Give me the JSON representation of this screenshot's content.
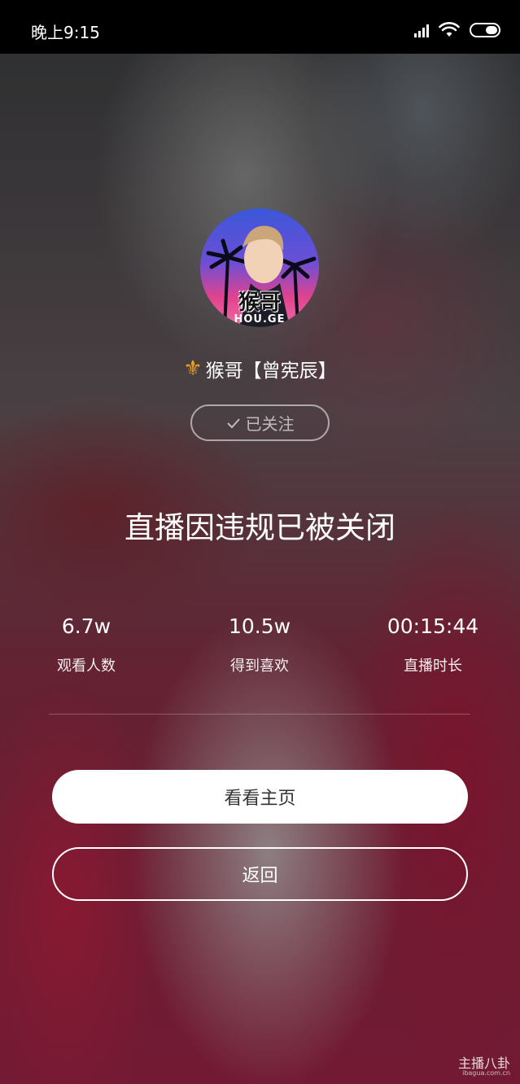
{
  "status_bar": {
    "time": "晚上9:15",
    "icons": [
      "signal-icon",
      "wifi-icon",
      "battery-icon"
    ]
  },
  "streamer": {
    "avatar_text": "猴哥",
    "avatar_subtext": "HOU.GE",
    "badge_icon": "fleur-de-lis-icon",
    "badge_color": "#f0a21f",
    "name": "猴哥【曾宪辰】"
  },
  "follow": {
    "label": "已关注",
    "icon": "check-icon"
  },
  "message": "直播因违规已被关闭",
  "stats": [
    {
      "value": "6.7w",
      "label": "观看人数"
    },
    {
      "value": "10.5w",
      "label": "得到喜欢"
    },
    {
      "value": "00:15:44",
      "label": "直播时长"
    }
  ],
  "buttons": {
    "home": "看看主页",
    "back": "返回"
  },
  "watermark": {
    "text": "主播八卦",
    "sub": "ibagua.com.cn"
  }
}
